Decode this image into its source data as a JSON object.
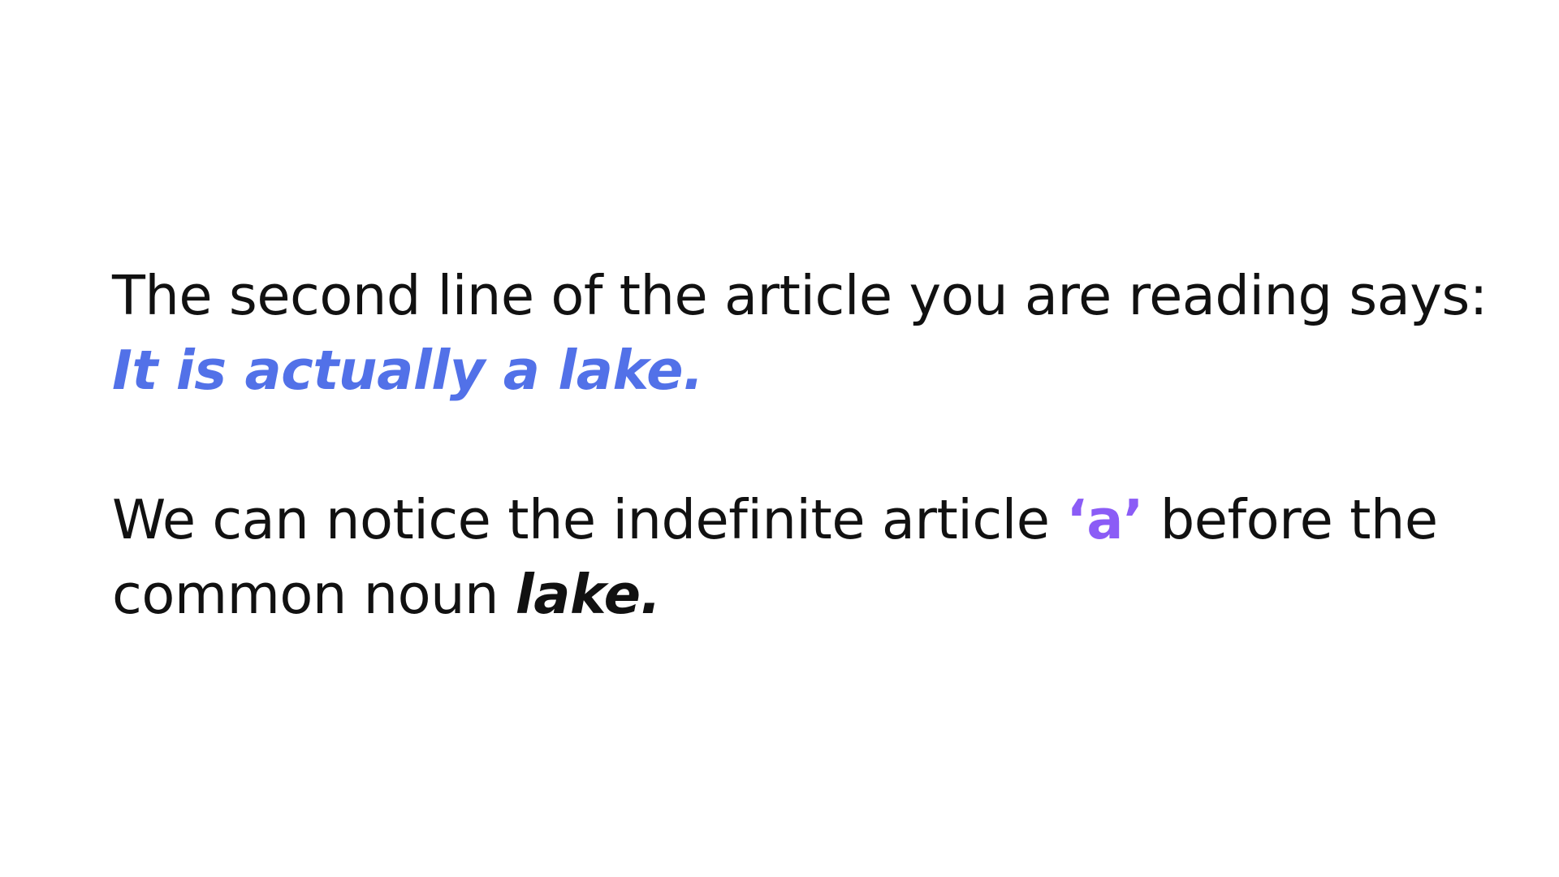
{
  "colors": {
    "background": "#ffffff",
    "body_text": "#111111",
    "quote": "#5271e8",
    "article_highlight": "#8b5cf6"
  },
  "paragraph1": {
    "intro": "The second line of the article you are reading says:",
    "quote": "It is actually a lake."
  },
  "paragraph2": {
    "line1_prefix": "We can notice the indefinite article ",
    "article": "‘a’",
    "line1_suffix": " before the",
    "line2_prefix": "common noun ",
    "noun": "lake."
  }
}
